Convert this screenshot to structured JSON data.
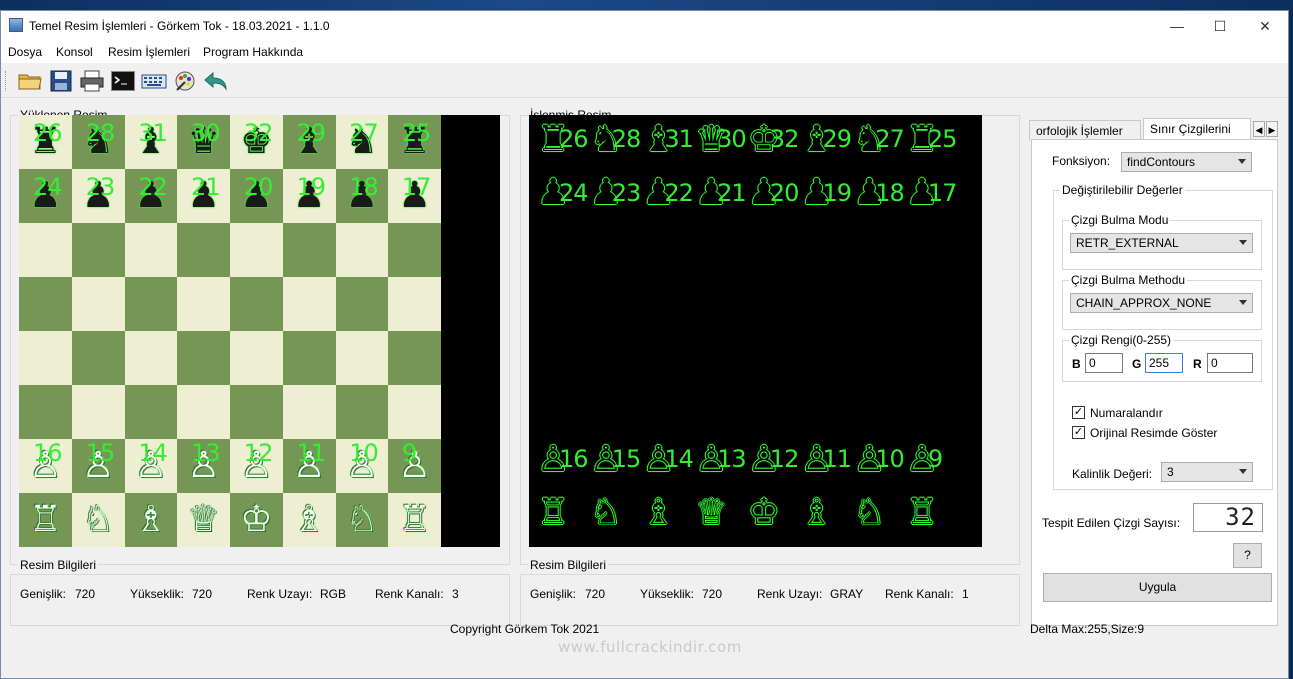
{
  "window": {
    "title": "Temel Resim İşlemleri - Görkem Tok - 18.03.2021 - 1.1.0",
    "controls": {
      "minimize": "—",
      "maximize": "☐",
      "close": "✕"
    }
  },
  "menu": [
    "Dosya",
    "Konsol",
    "Resim İşlemleri",
    "Program Hakkında"
  ],
  "toolbar": [
    "open-folder-icon",
    "save-icon",
    "print-icon",
    "console-icon",
    "keyboard-icon",
    "palette-icon",
    "undo-icon"
  ],
  "loaded_image": {
    "label": "Yüklenen Resim"
  },
  "processed_image": {
    "label": "İşlenmiş Resim"
  },
  "left_info": {
    "title": "Resim Bilgileri",
    "width_label": "Genişlik:",
    "width": "720",
    "height_label": "Yükseklik:",
    "height": "720",
    "colorspace_label": "Renk Uzayı:",
    "colorspace": "RGB",
    "channels_label": "Renk Kanalı:",
    "channels": "3"
  },
  "right_info": {
    "title": "Resim Bilgileri",
    "width_label": "Genişlik:",
    "width": "720",
    "height_label": "Yükseklik:",
    "height": "720",
    "colorspace_label": "Renk Uzayı:",
    "colorspace": "GRAY",
    "channels_label": "Renk Kanalı:",
    "channels": "1"
  },
  "tabs": [
    "orfolojik İşlemler",
    "Sınır Çizgilerini"
  ],
  "panel": {
    "function_label": "Fonksiyon:",
    "function_value": "findContours",
    "values_group": "Değiştirilebilir Değerler",
    "mode_group": "Çizgi Bulma Modu",
    "mode_value": "RETR_EXTERNAL",
    "method_group": "Çizgi Bulma Methodu",
    "method_value": "CHAIN_APPROX_NONE",
    "color_group": "Çizgi Rengi(0-255)",
    "b_label": "B",
    "b_value": "0",
    "g_label": "G",
    "g_value": "255",
    "r_label": "R",
    "r_value": "0",
    "numbering_label": "Numaralandır",
    "numbering_checked": true,
    "show_original_label": "Orijinal Resimde Göster",
    "show_original_checked": true,
    "thickness_label": "Kalinlik Değeri:",
    "thickness_value": "3",
    "detected_label": "Tespit Edilen Çizgi Sayısı:",
    "detected_value": "32",
    "help_button": "?",
    "apply_button": "Uygula"
  },
  "footer": {
    "copyright": "Copyright Görkem Tok 2021",
    "delta": "Delta Max:255,Size:9",
    "watermark": "www.fullcrackindir.com"
  },
  "board": {
    "ranks": [
      [
        "♜",
        "♞",
        "♝",
        "♛",
        "♚",
        "♝",
        "♞",
        "♜"
      ],
      [
        "♟",
        "♟",
        "♟",
        "♟",
        "♟",
        "♟",
        "♟",
        "♟"
      ],
      [
        "",
        "",
        "",
        "",
        "",
        "",
        "",
        ""
      ],
      [
        "",
        "",
        "",
        "",
        "",
        "",
        "",
        ""
      ],
      [
        "",
        "",
        "",
        "",
        "",
        "",
        "",
        ""
      ],
      [
        "",
        "",
        "",
        "",
        "",
        "",
        "",
        ""
      ],
      [
        "♙",
        "♙",
        "♙",
        "♙",
        "♙",
        "♙",
        "♙",
        "♙"
      ],
      [
        "♖",
        "♘",
        "♗",
        "♕",
        "♔",
        "♗",
        "♘",
        "♖"
      ]
    ],
    "contour_numbers_row1": [
      "26",
      "28",
      "31",
      "30",
      "32",
      "29",
      "27",
      "25"
    ],
    "contour_numbers_row2": [
      "24",
      "23",
      "22",
      "21",
      "20",
      "19",
      "18",
      "17"
    ],
    "contour_numbers_row7": [
      "16",
      "15",
      "14",
      "13",
      "12",
      "11",
      "10",
      "9"
    ],
    "contour_color": "#33ee33",
    "light_square": "#eeeed2",
    "dark_square": "#769656"
  }
}
